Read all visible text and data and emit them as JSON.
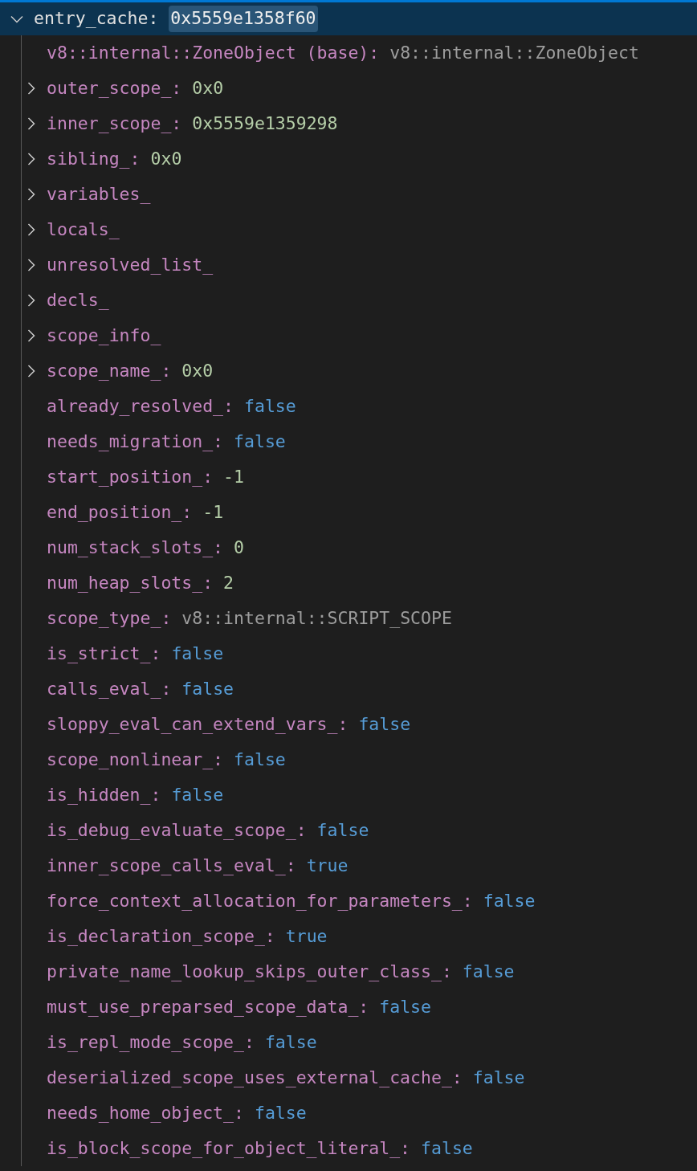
{
  "root": {
    "name": "entry_cache:",
    "value": "0x5559e1358f60",
    "expanded": true,
    "selected": true,
    "value_highlighted": true
  },
  "children": [
    {
      "name": "v8::internal::ZoneObject (base):",
      "value": "v8::internal::ZoneObject",
      "kind": "type",
      "expandable": false
    },
    {
      "name": "outer_scope_:",
      "value": "0x0",
      "kind": "number",
      "expandable": true
    },
    {
      "name": "inner_scope_:",
      "value": "0x5559e1359298",
      "kind": "number",
      "expandable": true
    },
    {
      "name": "sibling_:",
      "value": "0x0",
      "kind": "number",
      "expandable": true
    },
    {
      "name": "variables_",
      "expandable": true
    },
    {
      "name": "locals_",
      "expandable": true
    },
    {
      "name": "unresolved_list_",
      "expandable": true
    },
    {
      "name": "decls_",
      "expandable": true
    },
    {
      "name": "scope_info_",
      "expandable": true
    },
    {
      "name": "scope_name_:",
      "value": "0x0",
      "kind": "number",
      "expandable": true
    },
    {
      "name": "already_resolved_:",
      "value": "false",
      "kind": "boolean",
      "expandable": false
    },
    {
      "name": "needs_migration_:",
      "value": "false",
      "kind": "boolean",
      "expandable": false
    },
    {
      "name": "start_position_:",
      "value": "-1",
      "kind": "number",
      "expandable": false
    },
    {
      "name": "end_position_:",
      "value": "-1",
      "kind": "number",
      "expandable": false
    },
    {
      "name": "num_stack_slots_:",
      "value": "0",
      "kind": "number",
      "expandable": false
    },
    {
      "name": "num_heap_slots_:",
      "value": "2",
      "kind": "number",
      "expandable": false
    },
    {
      "name": "scope_type_:",
      "value": "v8::internal::SCRIPT_SCOPE",
      "kind": "type",
      "expandable": false
    },
    {
      "name": "is_strict_:",
      "value": "false",
      "kind": "boolean",
      "expandable": false
    },
    {
      "name": "calls_eval_:",
      "value": "false",
      "kind": "boolean",
      "expandable": false
    },
    {
      "name": "sloppy_eval_can_extend_vars_:",
      "value": "false",
      "kind": "boolean",
      "expandable": false
    },
    {
      "name": "scope_nonlinear_:",
      "value": "false",
      "kind": "boolean",
      "expandable": false
    },
    {
      "name": "is_hidden_:",
      "value": "false",
      "kind": "boolean",
      "expandable": false
    },
    {
      "name": "is_debug_evaluate_scope_:",
      "value": "false",
      "kind": "boolean",
      "expandable": false
    },
    {
      "name": "inner_scope_calls_eval_:",
      "value": "true",
      "kind": "boolean",
      "expandable": false
    },
    {
      "name": "force_context_allocation_for_parameters_:",
      "value": "false",
      "kind": "boolean",
      "expandable": false
    },
    {
      "name": "is_declaration_scope_:",
      "value": "true",
      "kind": "boolean",
      "expandable": false
    },
    {
      "name": "private_name_lookup_skips_outer_class_:",
      "value": "false",
      "kind": "boolean",
      "expandable": false
    },
    {
      "name": "must_use_preparsed_scope_data_:",
      "value": "false",
      "kind": "boolean",
      "expandable": false
    },
    {
      "name": "is_repl_mode_scope_:",
      "value": "false",
      "kind": "boolean",
      "expandable": false
    },
    {
      "name": "deserialized_scope_uses_external_cache_:",
      "value": "false",
      "kind": "boolean",
      "expandable": false
    },
    {
      "name": "needs_home_object_:",
      "value": "false",
      "kind": "boolean",
      "expandable": false
    },
    {
      "name": "is_block_scope_for_object_literal_:",
      "value": "false",
      "kind": "boolean",
      "expandable": false
    }
  ]
}
